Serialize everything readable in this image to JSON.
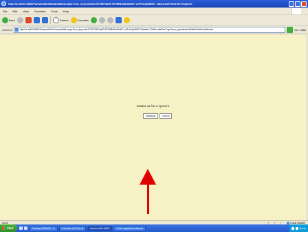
{
  "window": {
    "title": "http://ic-bd01:8080/FanamaWeb/fanamaWeb.aspx?eco_key=de10CJ0TN0Fadd0 5F2MBd0dd0dfd7 ccfFaCq0d0E0 - Microsoft Internet Explorer"
  },
  "menu": {
    "items": [
      "File",
      "Edit",
      "View",
      "Favorites",
      "Tools",
      "Help"
    ]
  },
  "toolbar": {
    "back_label": "Back",
    "search_label": "Search",
    "favorites_label": "Favorites"
  },
  "address": {
    "label": "Address",
    "url": "http://ic-bd01:8080/FanamaWeb/FanamaWeb.aspx?eco_key=de10CJ0TN0Fadd0 5F2MBd0dd0dfd7 ccfFaCq0d0E0 /Webdir4-PWEcoritaRus7=go/locus_jsmaleval/JeMde3e/A&ouldelhatat",
    "go_label": "Go",
    "links_label": "Links"
  },
  "dialog": {
    "prompt": "Заявка на бос в проекта",
    "buttons": [
      "заявщик",
      "cancel"
    ]
  },
  "annotation": {
    "color": "#e00000"
  },
  "status": {
    "text": "Done",
    "zone": "Local intranet"
  },
  "taskbar": {
    "start_label": "Start",
    "tasks": [
      {
        "label": "Desktop (H3DWD) - Ie",
        "active": false
      },
      {
        "label": "Calculator (FaCalc.ds",
        "active": false
      },
      {
        "label": "http://ic-bd01:8080/",
        "active": true
      },
      {
        "label": "Online Application Manual",
        "active": false
      }
    ],
    "tray_text": "Norsk"
  },
  "colors": {
    "content_background": "#f7f1c6",
    "titlebar": "#1f50c8",
    "taskbar": "#245bd0"
  }
}
